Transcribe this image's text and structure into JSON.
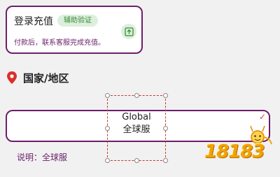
{
  "login_card": {
    "title": "登录充值",
    "badge": "辅助验证",
    "description": "付款后，联系客服完成充值。",
    "recharge_icon": "upload-box-icon"
  },
  "region": {
    "icon": "location-pin-icon",
    "label": "国家/地区"
  },
  "server": {
    "line1": "Global",
    "line2": "全球服",
    "note": "说明：全球服"
  },
  "logo": {
    "text": "18183"
  },
  "colors": {
    "accent": "#6b1f6b",
    "badge_bg": "#dcefdc",
    "badge_text": "#3a8a3a",
    "pin": "#d9302b",
    "selection": "#c23a2a",
    "logo": "#f2a300"
  }
}
